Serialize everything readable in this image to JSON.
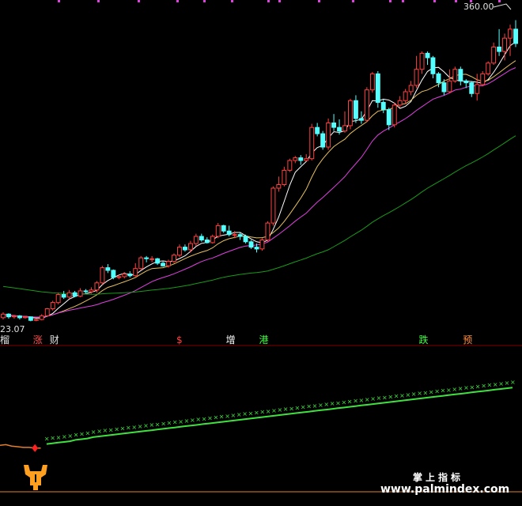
{
  "chart_data": [
    {
      "type": "candlestick",
      "title": "",
      "price_high_label": "360.00",
      "price_low_label": "23.07",
      "ylim": [
        18,
        372
      ],
      "colors": {
        "up": "#ff4040",
        "down": "#54ffff",
        "ma5": "#ffffff",
        "ma10": "#e8c060",
        "ma20": "#e040e0",
        "ma60": "#1a9a1a"
      },
      "candles": [
        {
          "o": 27,
          "c": 31,
          "h": 33,
          "l": 25
        },
        {
          "o": 31,
          "c": 28,
          "h": 32,
          "l": 26
        },
        {
          "o": 28,
          "c": 29,
          "h": 30,
          "l": 26
        },
        {
          "o": 29,
          "c": 27,
          "h": 30,
          "l": 25
        },
        {
          "o": 27,
          "c": 28,
          "h": 29,
          "l": 26
        },
        {
          "o": 28,
          "c": 24,
          "h": 28,
          "l": 23
        },
        {
          "o": 24,
          "c": 25,
          "h": 26,
          "l": 23
        },
        {
          "o": 25,
          "c": 29,
          "h": 31,
          "l": 24
        },
        {
          "o": 29,
          "c": 37,
          "h": 38,
          "l": 28
        },
        {
          "o": 37,
          "c": 44,
          "h": 46,
          "l": 35
        },
        {
          "o": 44,
          "c": 53,
          "h": 55,
          "l": 42
        },
        {
          "o": 53,
          "c": 50,
          "h": 57,
          "l": 48
        },
        {
          "o": 50,
          "c": 55,
          "h": 58,
          "l": 48
        },
        {
          "o": 55,
          "c": 51,
          "h": 57,
          "l": 50
        },
        {
          "o": 51,
          "c": 57,
          "h": 60,
          "l": 50
        },
        {
          "o": 57,
          "c": 56,
          "h": 59,
          "l": 54
        },
        {
          "o": 56,
          "c": 58,
          "h": 61,
          "l": 54
        },
        {
          "o": 58,
          "c": 66,
          "h": 68,
          "l": 55
        },
        {
          "o": 66,
          "c": 83,
          "h": 85,
          "l": 64
        },
        {
          "o": 83,
          "c": 80,
          "h": 87,
          "l": 77
        },
        {
          "o": 80,
          "c": 72,
          "h": 81,
          "l": 70
        },
        {
          "o": 72,
          "c": 73,
          "h": 75,
          "l": 70
        },
        {
          "o": 73,
          "c": 76,
          "h": 78,
          "l": 71
        },
        {
          "o": 76,
          "c": 74,
          "h": 79,
          "l": 72
        },
        {
          "o": 74,
          "c": 82,
          "h": 88,
          "l": 73
        },
        {
          "o": 82,
          "c": 94,
          "h": 96,
          "l": 80
        },
        {
          "o": 94,
          "c": 93,
          "h": 96,
          "l": 89
        },
        {
          "o": 93,
          "c": 93,
          "h": 96,
          "l": 89
        },
        {
          "o": 93,
          "c": 88,
          "h": 94,
          "l": 86
        },
        {
          "o": 88,
          "c": 85,
          "h": 90,
          "l": 84
        },
        {
          "o": 85,
          "c": 90,
          "h": 92,
          "l": 83
        },
        {
          "o": 90,
          "c": 97,
          "h": 99,
          "l": 88
        },
        {
          "o": 97,
          "c": 106,
          "h": 109,
          "l": 95
        },
        {
          "o": 106,
          "c": 103,
          "h": 109,
          "l": 101
        },
        {
          "o": 103,
          "c": 110,
          "h": 113,
          "l": 100
        },
        {
          "o": 110,
          "c": 118,
          "h": 121,
          "l": 107
        },
        {
          "o": 118,
          "c": 114,
          "h": 121,
          "l": 112
        },
        {
          "o": 114,
          "c": 111,
          "h": 117,
          "l": 110
        },
        {
          "o": 111,
          "c": 118,
          "h": 120,
          "l": 110
        },
        {
          "o": 118,
          "c": 130,
          "h": 133,
          "l": 116
        },
        {
          "o": 130,
          "c": 124,
          "h": 131,
          "l": 122
        },
        {
          "o": 124,
          "c": 120,
          "h": 130,
          "l": 118
        },
        {
          "o": 120,
          "c": 120,
          "h": 124,
          "l": 116
        },
        {
          "o": 120,
          "c": 118,
          "h": 123,
          "l": 114
        },
        {
          "o": 118,
          "c": 112,
          "h": 120,
          "l": 110
        },
        {
          "o": 112,
          "c": 106,
          "h": 114,
          "l": 104
        },
        {
          "o": 106,
          "c": 104,
          "h": 110,
          "l": 100
        },
        {
          "o": 104,
          "c": 114,
          "h": 116,
          "l": 102
        },
        {
          "o": 114,
          "c": 133,
          "h": 135,
          "l": 112
        },
        {
          "o": 133,
          "c": 172,
          "h": 174,
          "l": 130
        },
        {
          "o": 172,
          "c": 176,
          "h": 185,
          "l": 168
        },
        {
          "o": 176,
          "c": 192,
          "h": 196,
          "l": 174
        },
        {
          "o": 192,
          "c": 203,
          "h": 205,
          "l": 190
        },
        {
          "o": 203,
          "c": 206,
          "h": 208,
          "l": 200
        },
        {
          "o": 206,
          "c": 203,
          "h": 209,
          "l": 198
        },
        {
          "o": 203,
          "c": 205,
          "h": 210,
          "l": 202
        },
        {
          "o": 205,
          "c": 240,
          "h": 244,
          "l": 203
        },
        {
          "o": 240,
          "c": 233,
          "h": 245,
          "l": 230
        },
        {
          "o": 233,
          "c": 218,
          "h": 236,
          "l": 215
        },
        {
          "o": 218,
          "c": 245,
          "h": 250,
          "l": 215
        },
        {
          "o": 245,
          "c": 240,
          "h": 255,
          "l": 236
        },
        {
          "o": 240,
          "c": 236,
          "h": 249,
          "l": 232
        },
        {
          "o": 236,
          "c": 242,
          "h": 258,
          "l": 234
        },
        {
          "o": 242,
          "c": 270,
          "h": 272,
          "l": 238
        },
        {
          "o": 270,
          "c": 250,
          "h": 276,
          "l": 245
        },
        {
          "o": 250,
          "c": 248,
          "h": 258,
          "l": 244
        },
        {
          "o": 248,
          "c": 282,
          "h": 285,
          "l": 246
        },
        {
          "o": 282,
          "c": 300,
          "h": 302,
          "l": 279
        },
        {
          "o": 300,
          "c": 268,
          "h": 303,
          "l": 262
        },
        {
          "o": 268,
          "c": 260,
          "h": 271,
          "l": 256
        },
        {
          "o": 260,
          "c": 243,
          "h": 262,
          "l": 237
        },
        {
          "o": 243,
          "c": 265,
          "h": 268,
          "l": 240
        },
        {
          "o": 265,
          "c": 270,
          "h": 275,
          "l": 262
        },
        {
          "o": 270,
          "c": 280,
          "h": 283,
          "l": 266
        },
        {
          "o": 280,
          "c": 287,
          "h": 292,
          "l": 276
        },
        {
          "o": 287,
          "c": 305,
          "h": 320,
          "l": 284
        },
        {
          "o": 305,
          "c": 323,
          "h": 325,
          "l": 300
        },
        {
          "o": 323,
          "c": 318,
          "h": 325,
          "l": 310
        },
        {
          "o": 318,
          "c": 300,
          "h": 320,
          "l": 295
        },
        {
          "o": 300,
          "c": 290,
          "h": 302,
          "l": 285
        },
        {
          "o": 290,
          "c": 280,
          "h": 294,
          "l": 276
        },
        {
          "o": 280,
          "c": 292,
          "h": 305,
          "l": 278
        },
        {
          "o": 292,
          "c": 305,
          "h": 308,
          "l": 290
        },
        {
          "o": 305,
          "c": 292,
          "h": 308,
          "l": 287
        },
        {
          "o": 292,
          "c": 290,
          "h": 294,
          "l": 284
        },
        {
          "o": 290,
          "c": 278,
          "h": 292,
          "l": 274
        },
        {
          "o": 278,
          "c": 288,
          "h": 300,
          "l": 270
        },
        {
          "o": 288,
          "c": 300,
          "h": 303,
          "l": 286
        },
        {
          "o": 300,
          "c": 312,
          "h": 314,
          "l": 298
        },
        {
          "o": 312,
          "c": 330,
          "h": 335,
          "l": 310
        },
        {
          "o": 330,
          "c": 325,
          "h": 350,
          "l": 320
        },
        {
          "o": 325,
          "c": 340,
          "h": 345,
          "l": 315
        },
        {
          "o": 340,
          "c": 350,
          "h": 355,
          "l": 320
        },
        {
          "o": 350,
          "c": 334,
          "h": 360,
          "l": 330
        }
      ],
      "ma_periods": [
        5,
        10,
        20,
        60
      ]
    },
    {
      "type": "line",
      "title": "",
      "ylim": [
        0,
        100
      ],
      "line_values": [
        7,
        7,
        8,
        8,
        8,
        9,
        10,
        11,
        12,
        13,
        14,
        15,
        16,
        18,
        19,
        20,
        22,
        23,
        24,
        25,
        26,
        27,
        28,
        29,
        30,
        31,
        32,
        33,
        34,
        35,
        36,
        37,
        38,
        39,
        40,
        41,
        42,
        43,
        44,
        45,
        46,
        47,
        48,
        49,
        50,
        51,
        52,
        53,
        54,
        55,
        56,
        57,
        58,
        59,
        60,
        61,
        62,
        63,
        64,
        65,
        66,
        67,
        68,
        69,
        70,
        71,
        72,
        73,
        74,
        75,
        76,
        77,
        78,
        79,
        80,
        81,
        82,
        83,
        84,
        85,
        86,
        87,
        88,
        89,
        90,
        91,
        92,
        93,
        94
      ],
      "orange_values": [
        10,
        11,
        9,
        8,
        7,
        7,
        6,
        6
      ],
      "green_start": 8,
      "colors": {
        "orange": "#e08030",
        "green": "#40e040",
        "marker": "#ff2020"
      }
    }
  ],
  "events": [
    {
      "label": "榴",
      "color": "#e0e0e0",
      "index": 0
    },
    {
      "label": "涨",
      "color": "#ff5050",
      "index": 6
    },
    {
      "label": "财",
      "color": "#e0e0e0",
      "index": 9
    },
    {
      "label": "$",
      "color": "#ff4040",
      "index": 32
    },
    {
      "label": "增",
      "color": "#ffffff",
      "index": 41
    },
    {
      "label": "港",
      "color": "#40ff40",
      "index": 47
    },
    {
      "label": "跌",
      "color": "#40ff40",
      "index": 76
    },
    {
      "label": "预",
      "color": "#ff9040",
      "index": 84
    }
  ],
  "watermark": {
    "line1": "掌上指标",
    "line2": "www.palmindex.com"
  },
  "top_marks_color": "#e040e0"
}
